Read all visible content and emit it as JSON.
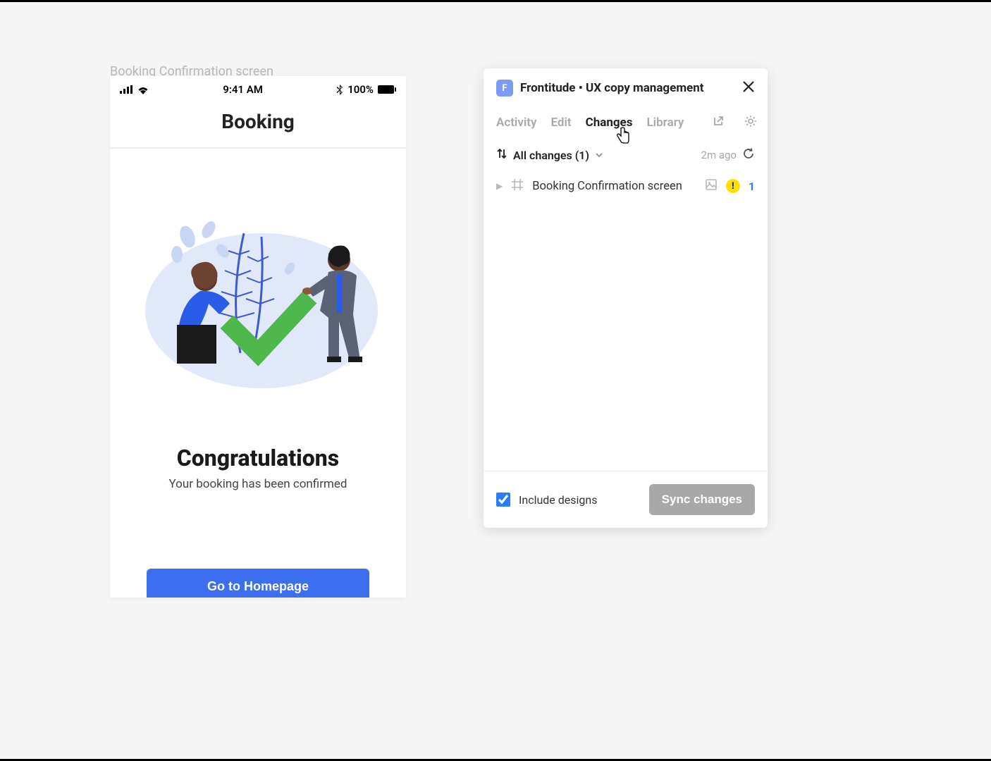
{
  "mobile": {
    "frame_label": "Booking Confirmation screen",
    "status": {
      "time": "9:41 AM",
      "battery_pct": "100%"
    },
    "header_title": "Booking",
    "congrats_title": "Congratulations",
    "congrats_subtitle": "Your booking has been confirmed",
    "homepage_button": "Go to Homepage"
  },
  "panel": {
    "logo_letter": "F",
    "title": "Frontitude • UX copy management",
    "tabs": {
      "activity": "Activity",
      "edit": "Edit",
      "changes": "Changes",
      "library": "Library"
    },
    "changes_filter": "All changes (1)",
    "time_ago": "2m ago",
    "change_item": {
      "name": "Booking Confirmation screen",
      "warn": "!",
      "count": "1"
    },
    "include_designs": "Include designs",
    "sync_button": "Sync changes"
  }
}
